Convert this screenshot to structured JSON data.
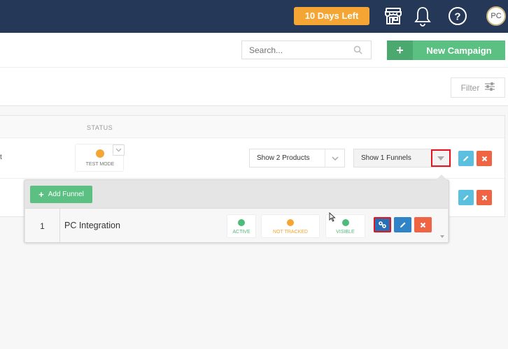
{
  "topbar": {
    "trial_label": "10 Days Left",
    "icons": [
      "store-icon",
      "bell-icon",
      "help-icon"
    ],
    "avatar_initials": "PC",
    "colors": {
      "background": "#253858",
      "trial": "#f5a534"
    }
  },
  "header": {
    "search_placeholder": "Search...",
    "new_campaign_label": "New Campaign",
    "new_campaign_icon": "+"
  },
  "filter": {
    "label": "Filter"
  },
  "table": {
    "columns": {
      "status": "STATUS"
    },
    "row1": {
      "status": "TEST MODE",
      "products_select": "Show 2 Products",
      "funnels_select": "Show 1 Funnels"
    }
  },
  "funnels_popover": {
    "add_label": "Add Funnel",
    "rows": [
      {
        "index": "1",
        "name": "PC Integration",
        "active": "ACTIVE",
        "tracking": "NOT TRACKED",
        "visibility": "VISIBLE"
      }
    ]
  },
  "colors": {
    "green": "#5cc083",
    "orange": "#f5a534",
    "edit_light": "#5bc0e0",
    "edit_dark": "#2f83c6",
    "delete": "#ef6443",
    "highlight": "#e8141f"
  }
}
